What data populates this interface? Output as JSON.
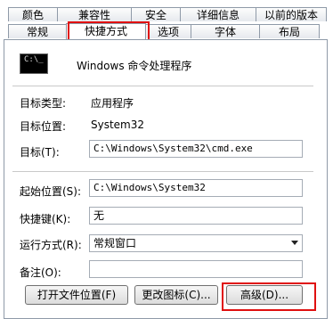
{
  "tabs_row1": [
    "颜色",
    "兼容性",
    "安全",
    "详细信息",
    "以前的版本"
  ],
  "tabs_row2": [
    "常规",
    "快捷方式",
    "选项",
    "字体",
    "布局"
  ],
  "active_tab": "快捷方式",
  "highlight_color": "#e01010",
  "icon_glyph": "C:\\_",
  "app_name": "Windows 命令处理程序",
  "fields": {
    "target_type_label": "目标类型:",
    "target_type_value": "应用程序",
    "target_location_label": "目标位置:",
    "target_location_value": "System32",
    "target_label": "目标(T):",
    "target_value": "C:\\Windows\\System32\\cmd.exe",
    "start_in_label": "起始位置(S):",
    "start_in_value": "C:\\Windows\\System32",
    "shortcut_key_label": "快捷键(K):",
    "shortcut_key_value": "无",
    "run_label": "运行方式(R):",
    "run_value": "常规窗口",
    "comment_label": "备注(O):",
    "comment_value": ""
  },
  "buttons": {
    "open_location": "打开文件位置(F)",
    "change_icon": "更改图标(C)...",
    "advanced": "高级(D)..."
  }
}
